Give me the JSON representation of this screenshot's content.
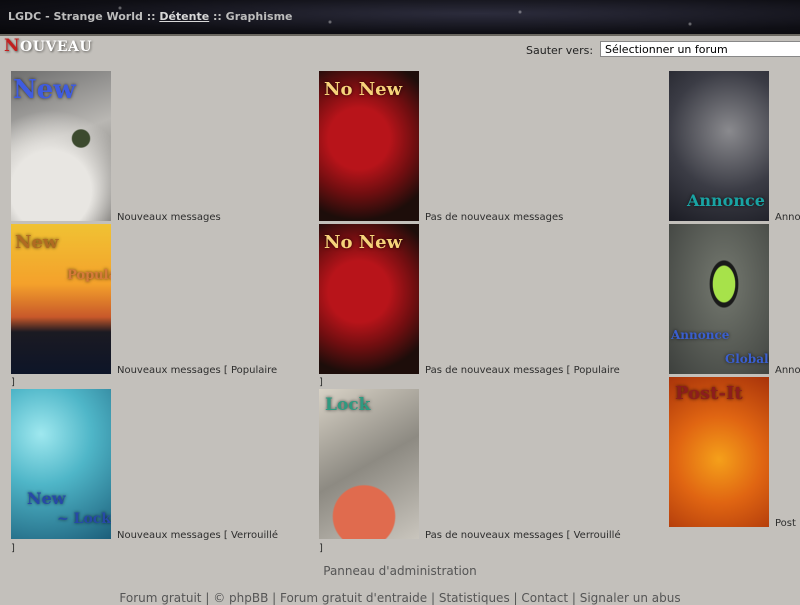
{
  "breadcrumb": {
    "site": "LGDC - Strange World",
    "sep1": " :: ",
    "section": "Détente",
    "sep2": " :: ",
    "current": "Graphisme"
  },
  "header": {
    "title_first": "N",
    "title_rest": "OUVEAU",
    "jump_label": "Sauter vers:",
    "jump_selected": "Sélectionner un forum"
  },
  "legend": {
    "col1": [
      {
        "icon_text": "New",
        "label": "Nouveaux messages",
        "bracket": ""
      },
      {
        "icon_text": "New",
        "icon_text2": "Popular",
        "label": "Nouveaux messages [ Populaire",
        "bracket": "]"
      },
      {
        "icon_text": "New",
        "icon_text2": "~ Lock",
        "label": "Nouveaux messages [ Verrouillé",
        "bracket": "]"
      }
    ],
    "col2": [
      {
        "icon_text": "No New",
        "label": "Pas de nouveaux messages",
        "bracket": ""
      },
      {
        "icon_text": "No New",
        "label": "Pas de nouveaux messages [ Populaire",
        "bracket": "]"
      },
      {
        "icon_text": "Lock",
        "label": "Pas de nouveaux messages [ Verrouillé",
        "bracket": "]"
      }
    ],
    "col3": [
      {
        "icon_text": "Annonce",
        "label": "Anno"
      },
      {
        "icon_text": "Annonce",
        "icon_text2": "Globale",
        "label": "Anno"
      },
      {
        "icon_text": "Post-It",
        "label": "Post"
      }
    ]
  },
  "admin_link": "Panneau d'administration",
  "footer": {
    "items": [
      "Forum gratuit",
      "© phpBB",
      "Forum gratuit d'entraide",
      "Statistiques",
      "Contact",
      "Signaler un abus"
    ],
    "separator": " | "
  },
  "colors": {
    "background": "#c3c0bb",
    "title_accent": "#c21f1f"
  }
}
